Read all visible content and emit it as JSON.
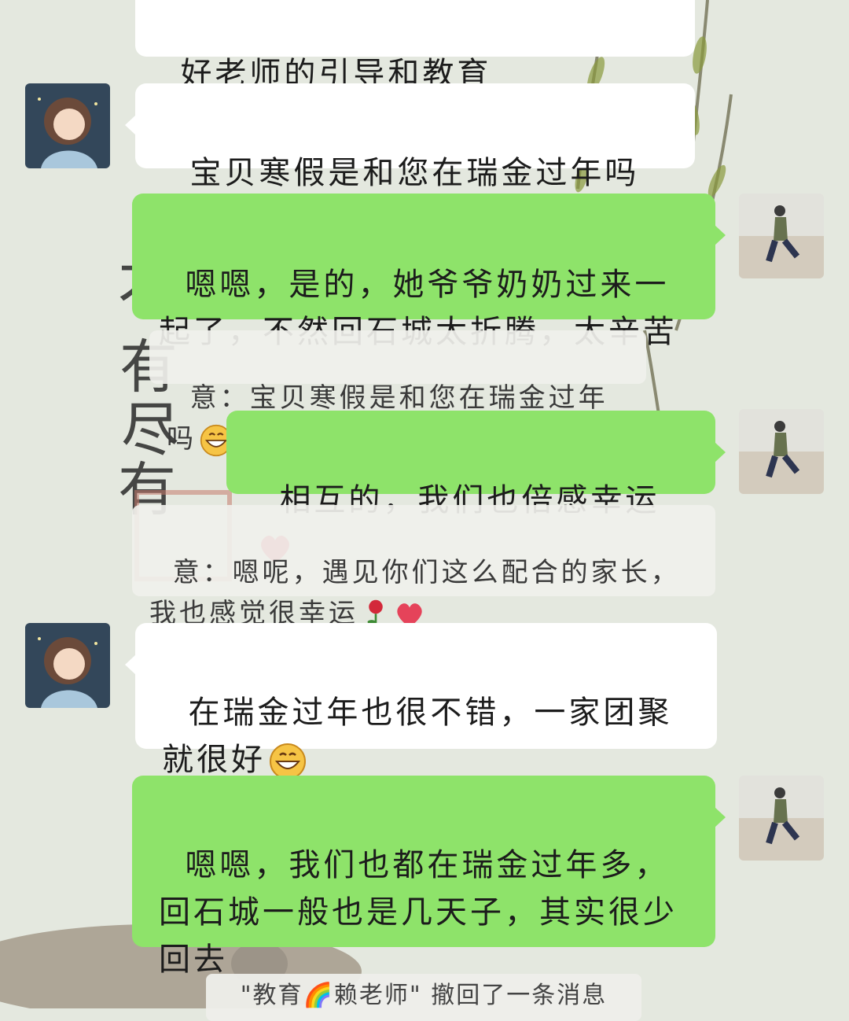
{
  "messages": {
    "m0_partial": "好老师的引导和教育",
    "m1": "宝贝寒假是和您在瑞金过年吗",
    "m2": "嗯嗯，是的，她爷爷奶奶过来一起了，不然回石城太折腾，太辛苦",
    "m2_quote_prefix": "意：",
    "m2_quote": "宝贝寒假是和您在瑞金过年吗",
    "m3": "相互的，我们也倍感幸运",
    "m3_quote_prefix": "意：",
    "m3_quote": "嗯呢，遇见你们这么配合的家长，我也感觉很幸运",
    "m4": "在瑞金过年也很不错，一家团聚就很好",
    "m5": "嗯嗯，我们也都在瑞金过年多，回石城一般也是几天子，其实很少回去",
    "recall": "\"教育🌈赖老师\" 撤回了一条消息"
  },
  "icons": {
    "grin": "grinning-face-emoji",
    "heart": "red-heart-emoji",
    "rose": "rose-emoji"
  },
  "colors": {
    "background": "#e4e8df",
    "sent_bubble": "#8ee36a",
    "received_bubble": "#ffffff"
  }
}
